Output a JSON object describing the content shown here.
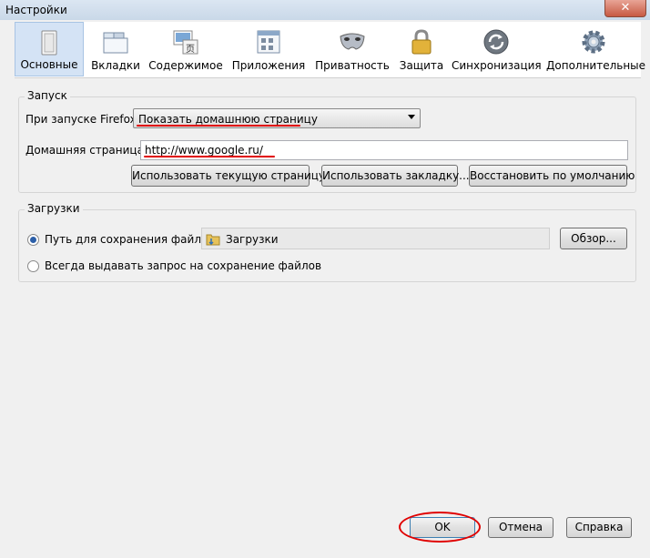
{
  "window": {
    "title": "Настройки"
  },
  "toolbar": {
    "items": [
      {
        "label": "Основные",
        "icon": "switch-icon",
        "selected": true
      },
      {
        "label": "Вкладки",
        "icon": "tabs-icon"
      },
      {
        "label": "Содержимое",
        "icon": "content-icon"
      },
      {
        "label": "Приложения",
        "icon": "applications-icon"
      },
      {
        "label": "Приватность",
        "icon": "mask-icon"
      },
      {
        "label": "Защита",
        "icon": "padlock-icon"
      },
      {
        "label": "Синхронизация",
        "icon": "sync-icon"
      },
      {
        "label": "Дополнительные",
        "icon": "gear-icon"
      }
    ]
  },
  "startup": {
    "group_title": "Запуск",
    "on_start_label": "При запуске Firefox:",
    "on_start_value": "Показать домашнюю страницу",
    "homepage_label": "Домашняя страница:",
    "homepage_value": "http://www.google.ru/",
    "use_current_button": "Использовать текущую страницу",
    "use_bookmark_button": "Использовать закладку...",
    "restore_default_button": "Восстановить по умолчанию"
  },
  "downloads": {
    "group_title": "Загрузки",
    "save_path_label": "Путь для сохранения файлов",
    "save_path_value": "Загрузки",
    "browse_button": "Обзор...",
    "always_ask_label": "Всегда выдавать запрос на сохранение файлов"
  },
  "footer": {
    "ok_button": "OK",
    "cancel_button": "Отмена",
    "help_button": "Справка"
  },
  "annotation_color": "#e00000"
}
